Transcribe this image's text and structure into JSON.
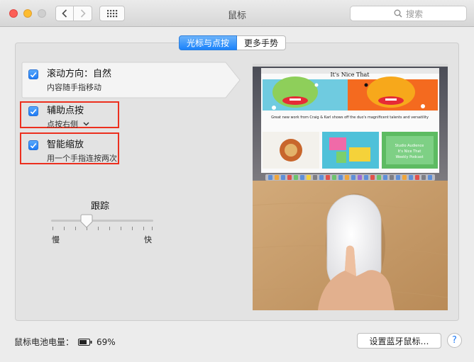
{
  "window": {
    "title": "鼠标"
  },
  "search": {
    "placeholder": "搜索"
  },
  "tabs": [
    {
      "label": "光标与点按",
      "active": true
    },
    {
      "label": "更多手势",
      "active": false
    }
  ],
  "options": [
    {
      "title": "滚动方向：自然",
      "subtitle": "内容随手指移动",
      "checked": true
    },
    {
      "title": "辅助点按",
      "subtitle": "点按右侧",
      "checked": true,
      "has_dropdown": true
    },
    {
      "title": "智能缩放",
      "subtitle": "用一个手指连按两次",
      "checked": true
    }
  ],
  "tracking": {
    "label": "跟踪",
    "min_label": "慢",
    "max_label": "快",
    "value_fraction": 0.36
  },
  "preview": {
    "browser_title": "It's Nice That",
    "headline": "Great new work from Craig & Karl shows off the duo's magnificent talents and versatility",
    "card_lines": [
      "Studio Audience",
      "It's Nice That",
      "Weekly Podcast"
    ]
  },
  "battery": {
    "label": "鼠标电池电量：",
    "percent": "69%"
  },
  "footer": {
    "bluetooth_button": "设置蓝牙鼠标…",
    "help": "?"
  },
  "colors": {
    "accent": "#1e7bf6",
    "highlight_box": "#ec2f1e"
  }
}
